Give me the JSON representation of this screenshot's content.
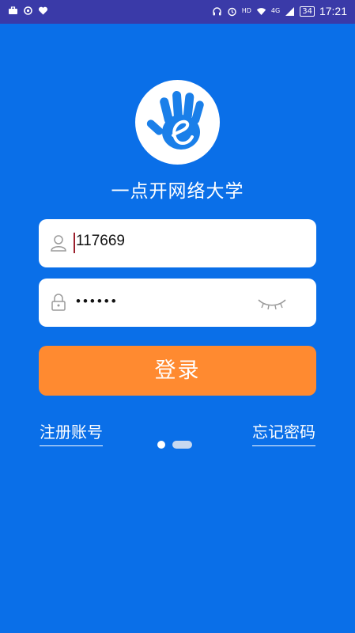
{
  "status_bar": {
    "time": "17:21",
    "battery": "34",
    "network_label": "HD",
    "signal_label": "4G",
    "icons_left": [
      "briefcase-icon",
      "sync-icon",
      "heart-monitor-icon"
    ],
    "icons_right": [
      "headset-icon",
      "alarm-icon",
      "hd-icon",
      "wifi-icon",
      "signal-icon",
      "battery-icon"
    ]
  },
  "app": {
    "title": "一点开网络大学",
    "logo_icon": "hand-e-logo-icon"
  },
  "login_form": {
    "username": {
      "value": "117669",
      "icon": "user-icon"
    },
    "password": {
      "masked_value": "••••••",
      "icon": "lock-icon",
      "toggle_icon": "eye-closed-icon"
    },
    "login_button": "登录"
  },
  "links": {
    "register": "注册账号",
    "forgot_password": "忘记密码"
  },
  "pager": {
    "count": 2,
    "active_index": 0
  },
  "colors": {
    "background": "#0a6fe8",
    "status_bar": "#3a3aa8",
    "button": "#ff8a30",
    "field": "#ffffff"
  }
}
